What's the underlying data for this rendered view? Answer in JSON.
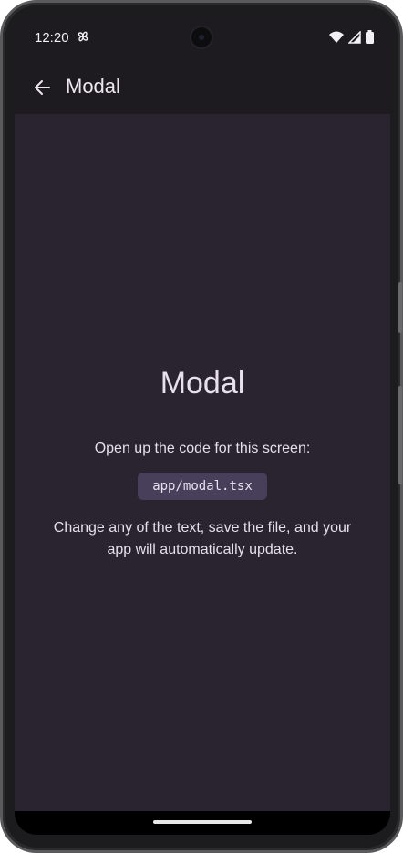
{
  "status_bar": {
    "time": "12:20",
    "icons": [
      "pinwheel-icon",
      "wifi-icon",
      "signal-icon",
      "battery-icon"
    ]
  },
  "app_bar": {
    "back_icon": "arrow-left-icon",
    "title": "Modal"
  },
  "main": {
    "heading": "Modal",
    "instruction": "Open up the code for this screen:",
    "code_path": "app/modal.tsx",
    "note": "Change any of the text, save the file, and your app will automatically update."
  },
  "colors": {
    "background": "#2a2430",
    "app_bar": "#1d1b1f",
    "code_chip": "#48405a",
    "text": "#e6dfea"
  }
}
